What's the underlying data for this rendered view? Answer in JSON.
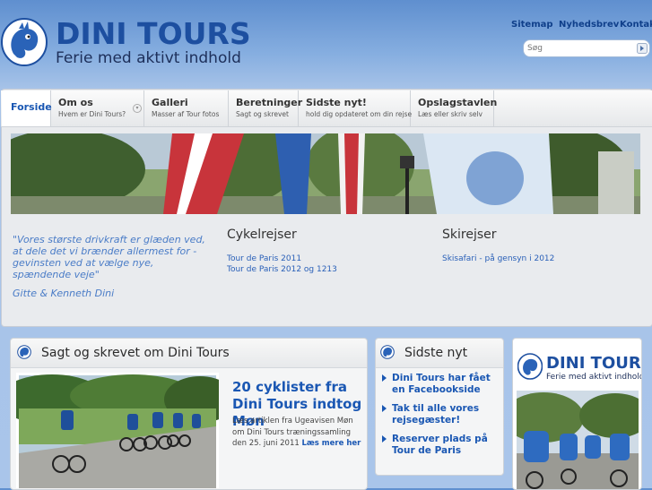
{
  "brand": {
    "name": "DINI TOURS",
    "tagline": "Ferie med aktivt indhold"
  },
  "top_links": [
    "Sitemap",
    "Nyhedsbrev",
    "Kontakt"
  ],
  "search": {
    "placeholder": "Søg"
  },
  "nav": [
    {
      "title": "Forside",
      "sub": ""
    },
    {
      "title": "Om os",
      "sub": "Hvem er Dini Tours?"
    },
    {
      "title": "Galleri",
      "sub": "Masser af Tour fotos"
    },
    {
      "title": "Beretninger",
      "sub": "Sagt og skrevet"
    },
    {
      "title": "Sidste nyt!",
      "sub": "hold dig opdateret om din rejse"
    },
    {
      "title": "Opslagstavlen",
      "sub": "Læs eller skriv selv"
    }
  ],
  "quote": {
    "text": "\"Vores største drivkraft er glæden ved, at dele det vi brænder allermest for - gevinsten ved at vælge nye, spændende veje\"",
    "author": "Gitte & Kenneth Dini"
  },
  "cycling": {
    "title": "Cykelrejser",
    "links": [
      "Tour de Paris 2011",
      "Tour de Paris 2012 og 1213"
    ]
  },
  "skiing": {
    "title": "Skirejser",
    "links": [
      "Skisafari - på gensyn i 2012"
    ]
  },
  "press_box": {
    "title": "Sagt og skrevet om Dini Tours",
    "article_title": "20 cyklister fra Dini Tours indtog Møn",
    "article_text": "Læs artiklen fra Ugeavisen Møn om Dini Tours træningssamling den 25. juni 2011",
    "read_more": "Læs mere her"
  },
  "news_box": {
    "title": "Sidste nyt",
    "items": [
      "Dini Tours har fået en Facebookside",
      "Tak til alle vores rejsegæster!",
      "Reserver plads på Tour de Paris"
    ]
  },
  "ad_box": {
    "name": "DINI TOURS",
    "tagline": "Ferie med aktivt indhold"
  },
  "colors": {
    "brand_blue": "#1d4fa0",
    "link_blue": "#1a57b3",
    "quote_blue": "#4a7cc7"
  }
}
